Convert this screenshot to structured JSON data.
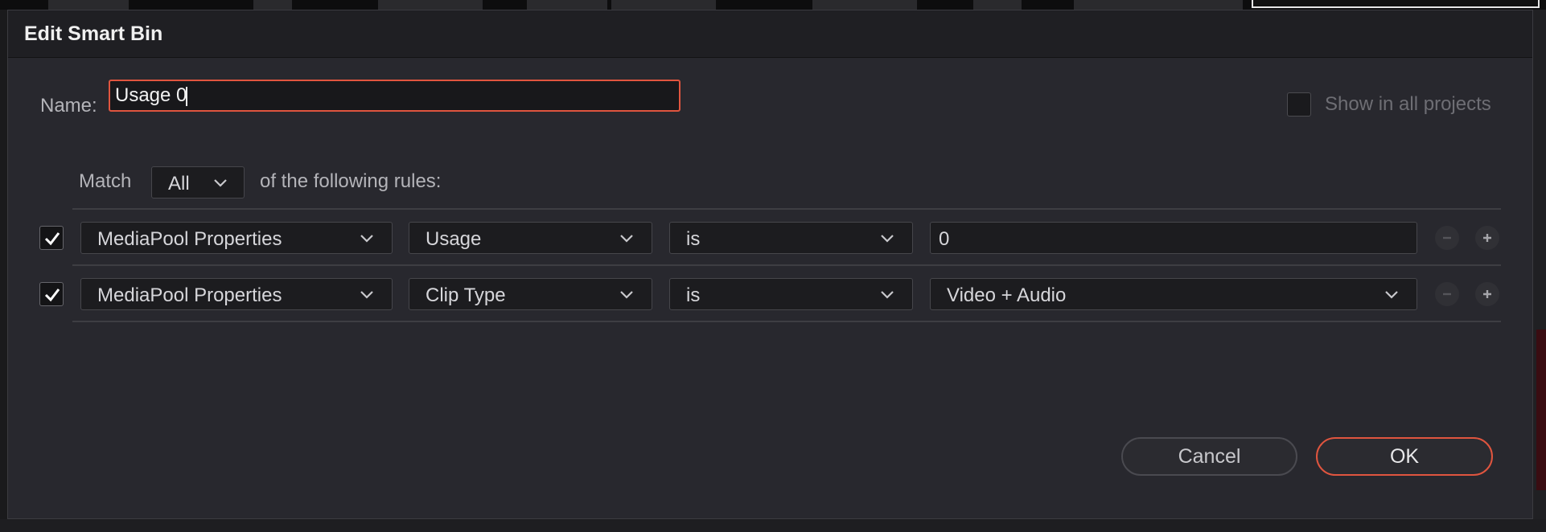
{
  "dialog": {
    "title": "Edit Smart Bin",
    "name_label": "Name:",
    "name_value": "Usage 0",
    "show_all_projects_label": "Show in all projects",
    "show_all_projects_checked": false,
    "match_label": "Match",
    "match_value": "All",
    "rules_suffix": "of the following rules:",
    "rules": [
      {
        "enabled": true,
        "category": "MediaPool Properties",
        "property": "Usage",
        "operator": "is",
        "value": "0"
      },
      {
        "enabled": true,
        "category": "MediaPool Properties",
        "property": "Clip Type",
        "operator": "is",
        "value": "Video + Audio"
      }
    ],
    "cancel_label": "Cancel",
    "ok_label": "OK"
  },
  "colors": {
    "accent": "#e0553f",
    "dialog_bg": "#28282e",
    "titlebar_bg": "#1f1f23"
  },
  "icons": {
    "check": "checkmark-icon",
    "chevron": "chevron-down-icon",
    "remove": "minus-icon",
    "add": "plus-icon"
  }
}
